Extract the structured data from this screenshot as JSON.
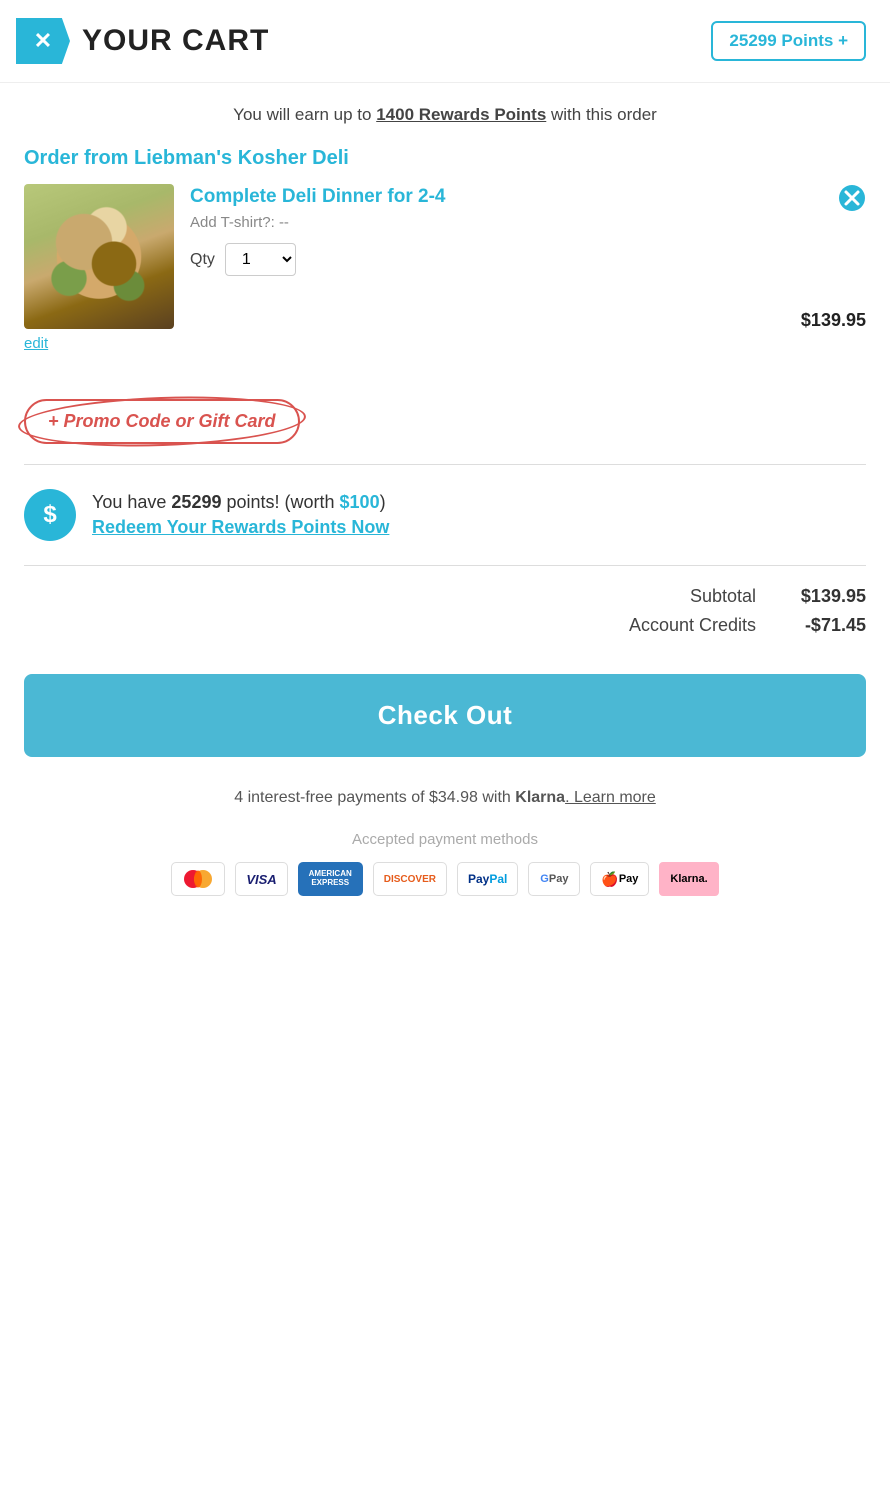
{
  "header": {
    "logo_symbol": "✕",
    "title": "YOUR CART",
    "points_label": "25299 Points +"
  },
  "rewards_bar": {
    "text_before": "You will earn up to ",
    "points_text": "1400 Rewards Points",
    "text_after": " with this order"
  },
  "order": {
    "from_label": "Order from",
    "restaurant": "Liebman's Kosher Deli",
    "item": {
      "name": "Complete Deli Dinner for 2-4",
      "option_label": "Add T-shirt?:",
      "option_value": " --",
      "qty_label": "Qty",
      "qty_value": "1",
      "price": "$139.95",
      "edit_label": "edit"
    }
  },
  "promo": {
    "button_label": "+ Promo Code or Gift Card"
  },
  "rewards_section": {
    "icon": "$",
    "text_before": "You have ",
    "points": "25299",
    "text_mid": " points! (worth ",
    "worth": "$100",
    "text_after": ")",
    "redeem_label": "Redeem Your Rewards Points Now"
  },
  "totals": {
    "subtotal_label": "Subtotal",
    "subtotal_value": "$139.95",
    "credits_label": "Account Credits",
    "credits_value": "-$71.45"
  },
  "checkout": {
    "button_label": "Check Out"
  },
  "klarna": {
    "text": "4 interest-free payments of $34.98 with ",
    "brand": "Klarna",
    "link": ". Learn more"
  },
  "payment_methods": {
    "label": "Accepted payment methods",
    "icons": [
      {
        "name": "mastercard",
        "display": "MC"
      },
      {
        "name": "visa",
        "display": "VISA"
      },
      {
        "name": "amex",
        "display": "AMERICAN EXPRESS"
      },
      {
        "name": "discover",
        "display": "DISCOVER"
      },
      {
        "name": "paypal",
        "display": "PayPal"
      },
      {
        "name": "gpay",
        "display": "G Pay"
      },
      {
        "name": "applepay",
        "display": "Pay"
      },
      {
        "name": "klarna-pay",
        "display": "Klarna."
      }
    ]
  }
}
